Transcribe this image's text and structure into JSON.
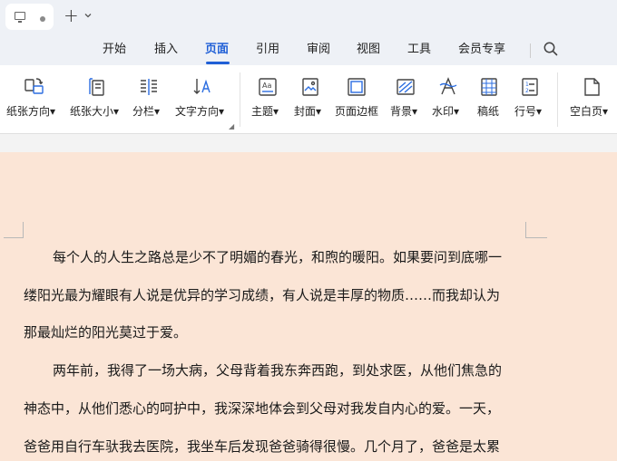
{
  "window": {
    "tab_icons": [
      "monitor-icon",
      "dot-icon"
    ],
    "new_tab_plus": "+",
    "new_tab_chevron": "⌄"
  },
  "menu": {
    "items": [
      "开始",
      "插入",
      "页面",
      "引用",
      "审阅",
      "视图",
      "工具",
      "会员专享"
    ],
    "active_index": 2,
    "accent_color": "#1f5fd6"
  },
  "ribbon": {
    "tools": [
      {
        "label": "纸张方向",
        "icon": "page-orientation-icon",
        "dropdown": true
      },
      {
        "label": "纸张大小",
        "icon": "page-size-icon",
        "dropdown": true
      },
      {
        "label": "分栏",
        "icon": "columns-icon",
        "dropdown": true
      },
      {
        "label": "文字方向",
        "icon": "text-direction-icon",
        "dropdown": true
      },
      {
        "label": "主题",
        "icon": "theme-icon",
        "dropdown": true
      },
      {
        "label": "封面",
        "icon": "cover-page-icon",
        "dropdown": true
      },
      {
        "label": "页面边框",
        "icon": "page-border-icon",
        "dropdown": false
      },
      {
        "label": "背景",
        "icon": "background-icon",
        "dropdown": true
      },
      {
        "label": "水印",
        "icon": "watermark-icon",
        "dropdown": true
      },
      {
        "label": "稿纸",
        "icon": "manuscript-paper-icon",
        "dropdown": false
      },
      {
        "label": "行号",
        "icon": "line-numbers-icon",
        "dropdown": true
      },
      {
        "label": "空白页",
        "icon": "blank-page-icon",
        "dropdown": true
      }
    ]
  },
  "document": {
    "background_color": "#fbe5d6",
    "lines": [
      "每个人的人生之路总是少不了明媚的春光，和煦的暖阳。如果要问到底哪一",
      "缕阳光最为耀眼有人说是优异的学习成绩，有人说是丰厚的物质……而我却认为",
      "那最灿烂的阳光莫过于爱。",
      "两年前，我得了一场大病，父母背着我东奔西跑，到处求医，从他们焦急的",
      "神态中，从他们悉心的呵护中，我深深地体会到父母对我发自内心的爱。一天，",
      "爸爸用自行车驮我去医院，我坐车后发现爸爸骑得很慢。几个月了，爸爸是太累"
    ]
  }
}
